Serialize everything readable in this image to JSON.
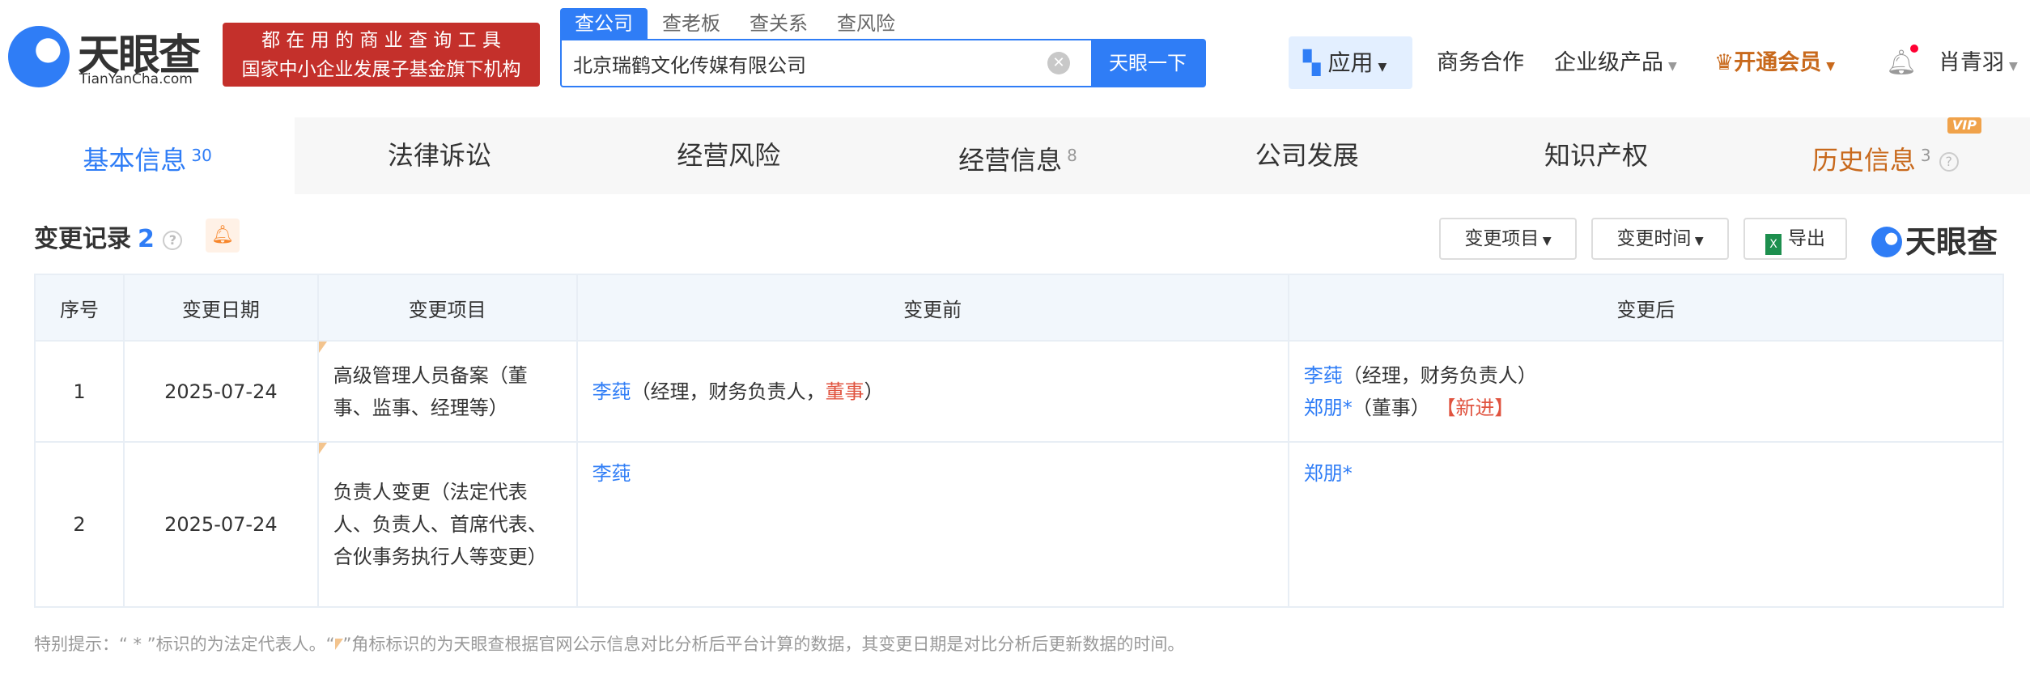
{
  "header": {
    "logo": {
      "name": "天眼查",
      "domain": "TianYanCha.com"
    },
    "slogan": [
      "都 在 用 的 商 业 查 询 工 具",
      "国家中小企业发展子基金旗下机构"
    ],
    "search_tabs": [
      "查公司",
      "查老板",
      "查关系",
      "查风险"
    ],
    "search_value": "北京瑞鹤文化传媒有限公司",
    "search_button": "天眼一下",
    "nav": {
      "app": "应用",
      "business": "商务合作",
      "enterprise": "企业级产品",
      "vip": "开通会员",
      "user": "肖青羽"
    }
  },
  "tabs": [
    {
      "label": "基本信息",
      "count": "30"
    },
    {
      "label": "法律诉讼",
      "count": ""
    },
    {
      "label": "经营风险",
      "count": ""
    },
    {
      "label": "经营信息",
      "count": "8"
    },
    {
      "label": "公司发展",
      "count": ""
    },
    {
      "label": "知识产权",
      "count": ""
    },
    {
      "label": "历史信息",
      "count": "3",
      "badge": "VIP"
    }
  ],
  "section": {
    "title": "变更记录",
    "count": "2",
    "filter1": "变更项目",
    "filter2": "变更时间",
    "export": "导出",
    "watermark": "天眼查"
  },
  "table": {
    "headers": [
      "序号",
      "变更日期",
      "变更项目",
      "变更前",
      "变更后"
    ],
    "rows": [
      {
        "no": "1",
        "date": "2025-07-24",
        "item": "高级管理人员备案（董事、监事、经理等）",
        "before": {
          "name": "李莼",
          "pre": "（经理，财务负责人，",
          "hl": "董事",
          "post": "）"
        },
        "after": [
          {
            "name": "李莼",
            "text": "（经理，财务负责人）",
            "tag": ""
          },
          {
            "name": "郑朋*",
            "text": "（董事）",
            "tag": "【新进】"
          }
        ]
      },
      {
        "no": "2",
        "date": "2025-07-24",
        "item": "负责人变更（法定代表人、负责人、首席代表、合伙事务执行人等变更）",
        "before": {
          "name": "李莼"
        },
        "after": [
          {
            "name": "郑朋*"
          }
        ]
      }
    ]
  },
  "note": {
    "a": "特别提示：“ * ”标识的为法定代表人。“",
    "b": "”角标标识的为天眼查根据官网公示信息对比分析后平台计算的数据，其变更日期是对比分析后更新数据的时间。"
  }
}
